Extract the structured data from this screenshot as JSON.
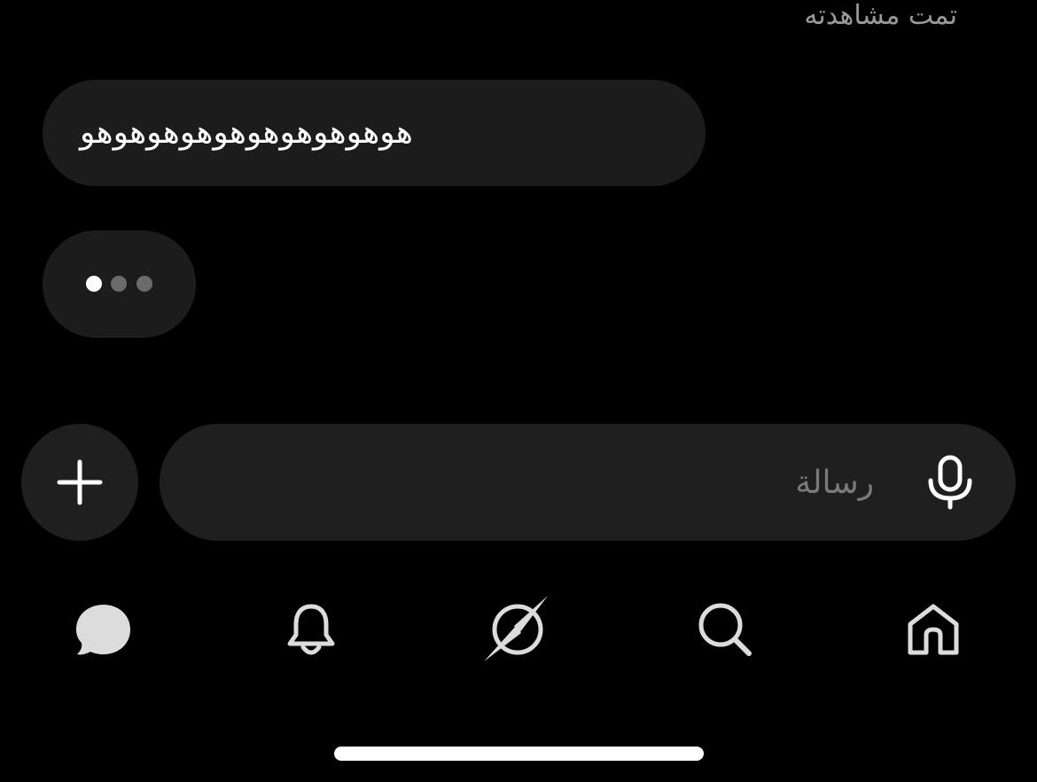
{
  "conversation": {
    "seen_status": "تمت مشاهدته",
    "messages": [
      {
        "text": "هوهوهوهوهوهوهوهوهوهو"
      }
    ],
    "typing_indicator": true
  },
  "composer": {
    "placeholder": "رسالة"
  },
  "icons": {
    "add": "plus-icon",
    "mic": "microphone-icon",
    "messages": "chat-bubble-icon",
    "notifications": "bell-icon",
    "explore": "compass-icon",
    "search": "search-icon",
    "home": "home-icon"
  },
  "colors": {
    "background": "#000000",
    "bubble": "#1c1c1c",
    "composer": "#1f1f1f",
    "placeholder": "#7a7a7a",
    "secondary_text": "#9a9a9a"
  }
}
